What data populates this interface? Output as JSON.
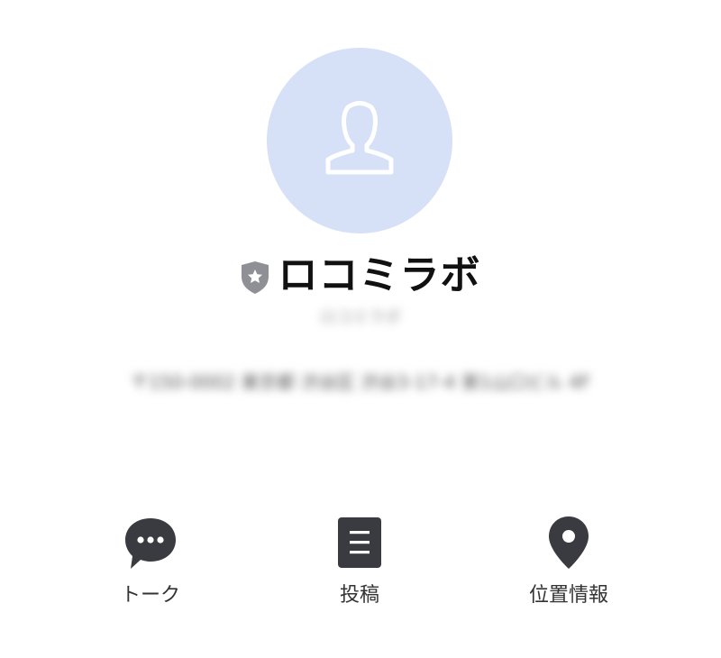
{
  "profile": {
    "name": "ロコミラボ",
    "badge_icon": "verified-shield-icon",
    "avatar_icon": "default-user-icon",
    "status_message": "ロコミラボ",
    "address": "〒150-0002 東京都 渋谷区 渋谷3-17-4 第1山口ビル 4F"
  },
  "actions": [
    {
      "label": "トーク",
      "icon": "chat-bubble-icon"
    },
    {
      "label": "投稿",
      "icon": "posts-list-icon"
    },
    {
      "label": "位置情報",
      "icon": "location-pin-icon"
    }
  ],
  "colors": {
    "avatar_bg": "#d6e0f7",
    "icon_dark": "#3a3b40",
    "badge_gray": "#8e9096"
  }
}
